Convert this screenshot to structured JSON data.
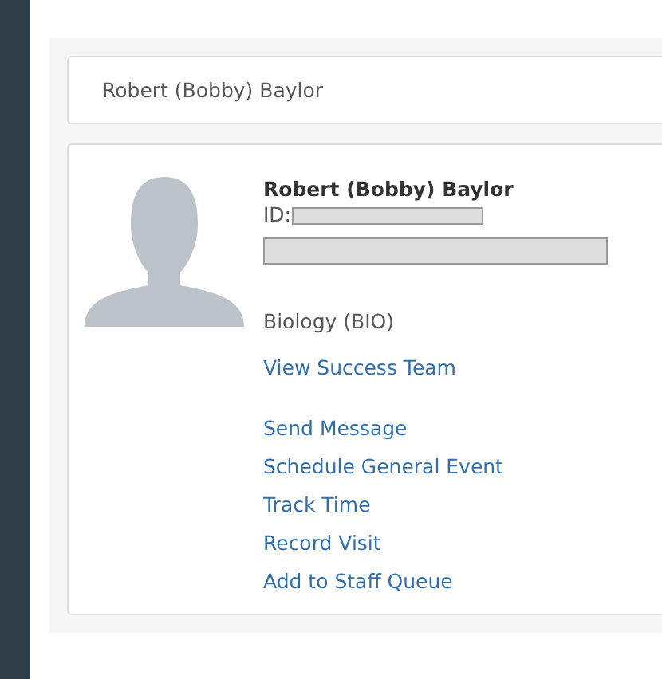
{
  "header": {
    "name": "Robert (Bobby) Baylor"
  },
  "card": {
    "name": "Robert (Bobby) Baylor",
    "id_label": "ID:",
    "program": "Biology (BIO)",
    "team_link": "View Success Team",
    "actions": [
      "Send Message",
      "Schedule General Event",
      "Track Time",
      "Record Visit",
      "Add to Staff Queue"
    ]
  }
}
